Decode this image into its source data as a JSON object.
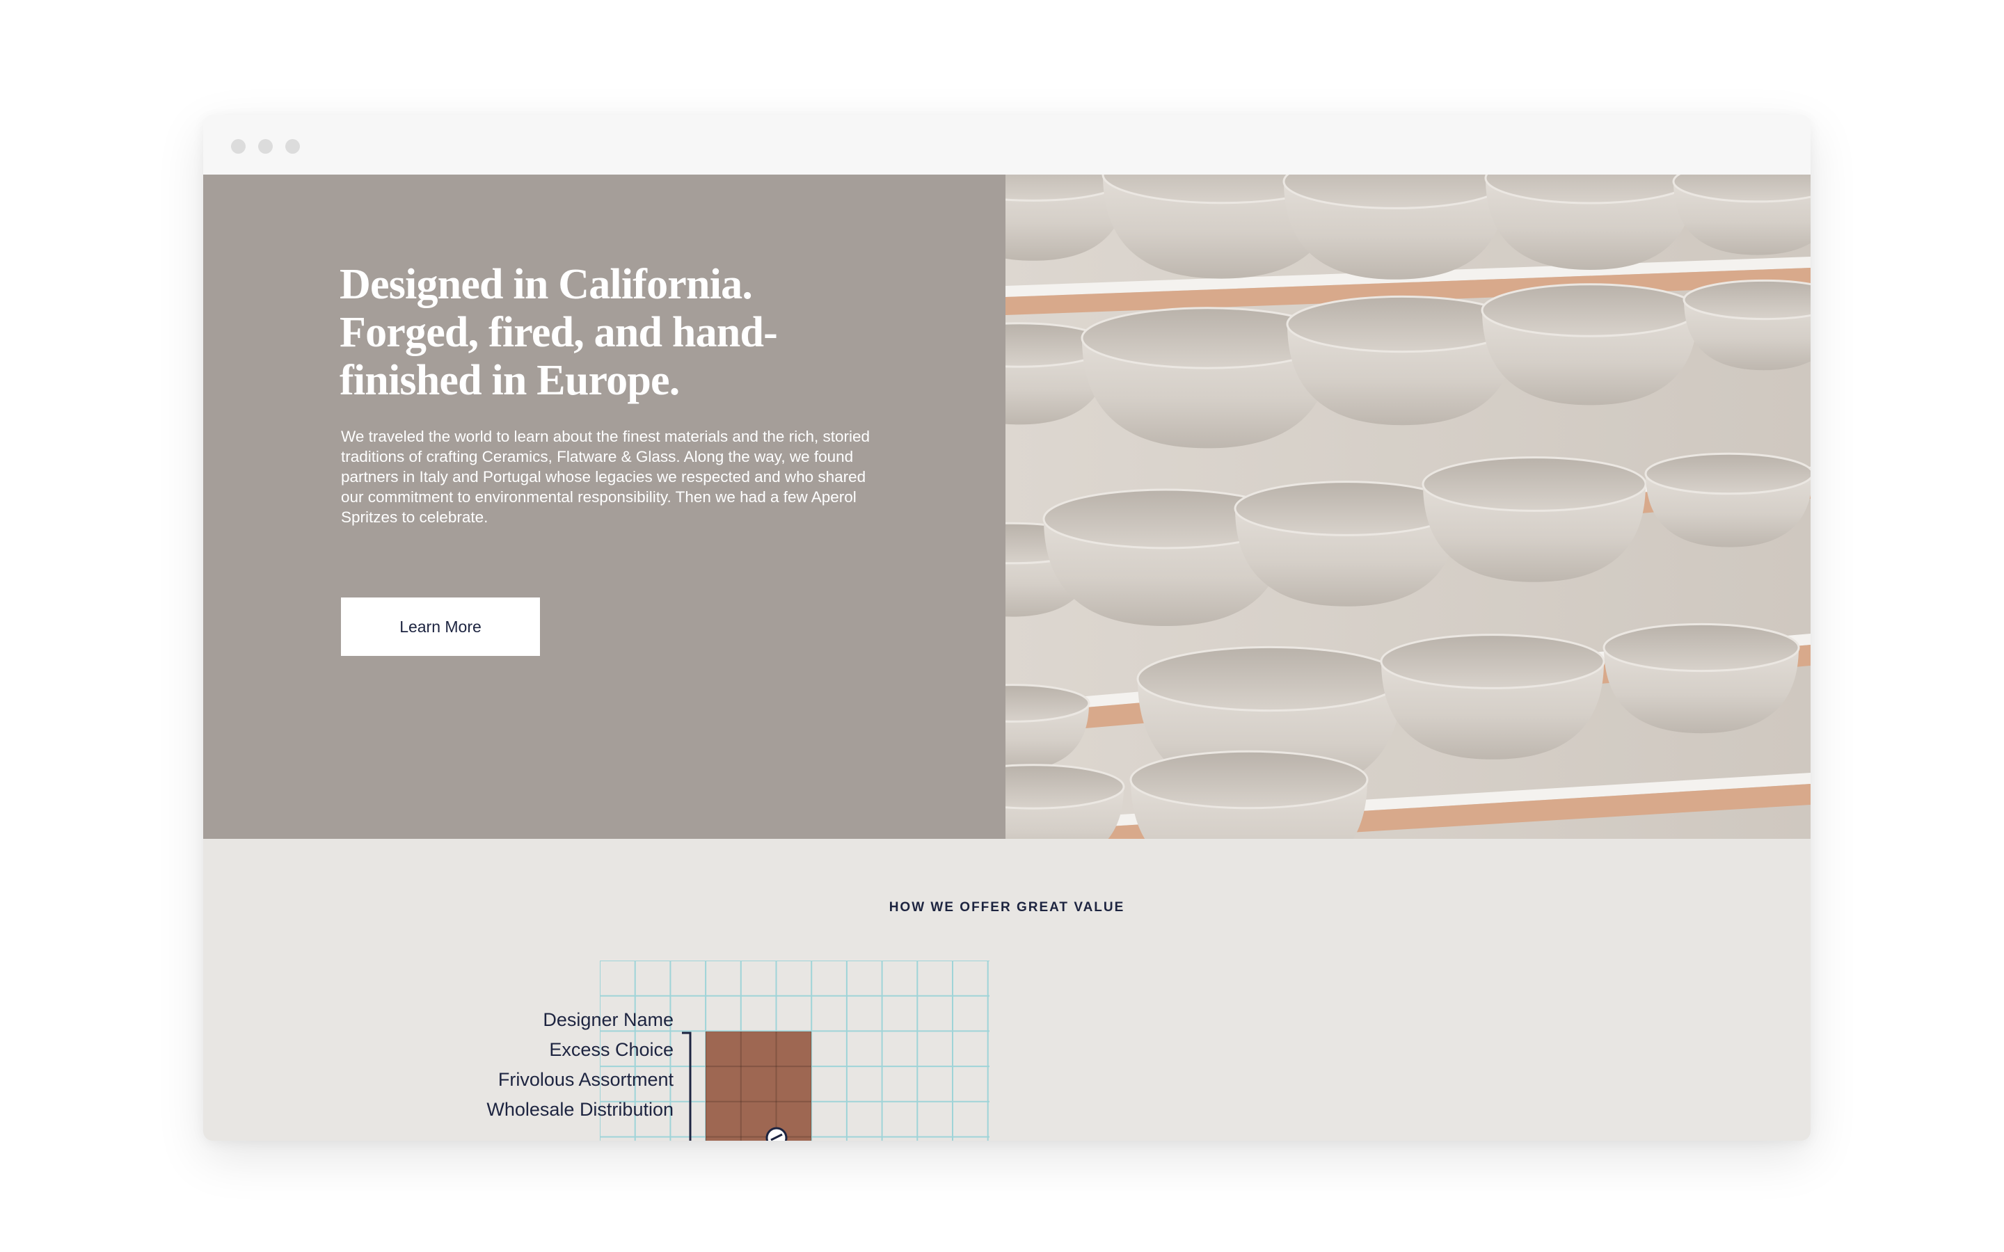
{
  "window": {
    "controls": [
      "close-dot",
      "minimize-dot",
      "maximize-dot"
    ]
  },
  "hero": {
    "title": "Designed in California. Forged, fired, and hand-finished in Europe.",
    "body": "We traveled the world to learn about the finest materials and the rich, storied traditions of crafting Ceramics, Flatware & Glass. Along the way, we found partners in Italy and Portugal whose legacies we respected and who shared our commitment to environmental responsibility. Then we had a few Aperol Spritzes to celebrate.",
    "cta_label": "Learn More",
    "background_color": "#a59e99",
    "image_subject": "shelves of unglazed ceramic bowls"
  },
  "value_section": {
    "heading": "HOW WE OFFER GREAT VALUE",
    "labels": [
      "Designer Name",
      "Excess Choice",
      "Frivolous Assortment",
      "Wholesale Distribution"
    ],
    "highlight_color": "#9e6752",
    "grid_color": "#9fd4d8"
  }
}
